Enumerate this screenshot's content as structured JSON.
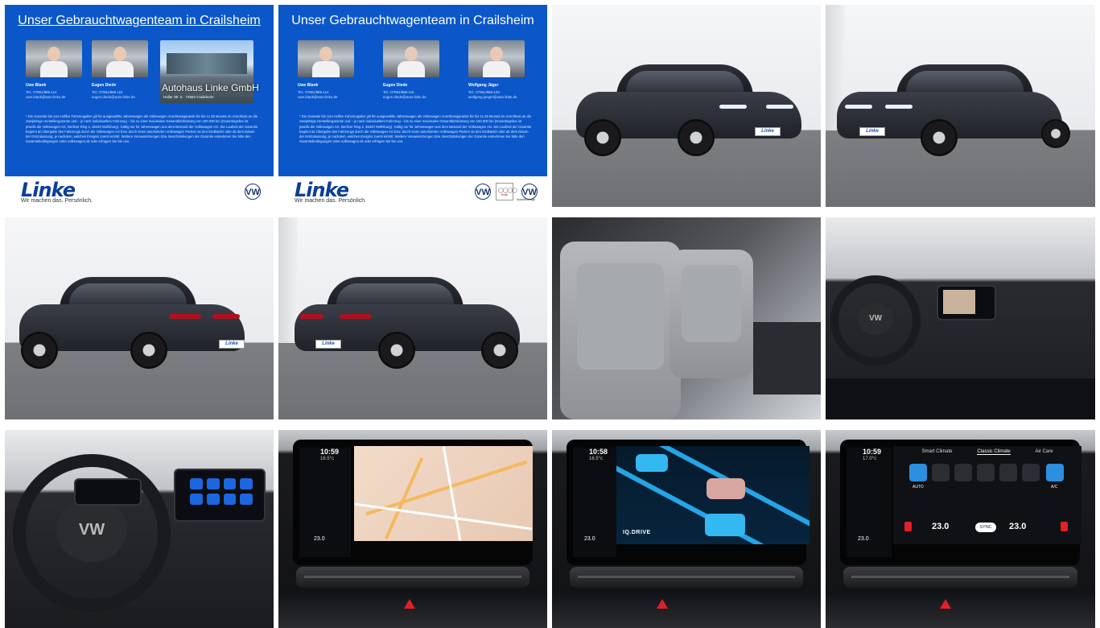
{
  "gallery": {
    "dealer_tile_1": {
      "heading": "Unser Gebrauchtwagenteam in Crailsheim",
      "staff": [
        {
          "name": "Uwe Blank",
          "contact": "Tel.: 07951/985-114\nuwe.blank@auto-linke.de"
        },
        {
          "name": "Eugen Diede",
          "contact": "Tel.: 07951/985-115\neugen.diede@auto-linke.de"
        }
      ],
      "building_label": "Autohaus Linke GmbH",
      "building_address": "Haller Str. 6 · 74564 Crailsheim",
      "fineprint": "* Die Garantie bis zum Hoffen Fahrzeugalter gilt für ausgewählte Jahreswagen als Volkswagen Anschlussgarantie für bis zu 36 Monate im Anschluss an die zweijährige Herstellergarantie und – je nach individuellem Fahrzeug – bis zu einer maximalen Gesamtfahrleistung von 100.000 km (Garantiegeber ist jeweils die Volkswagen AG, Berliner Ring 2, 38440 Wolfsburg). Gültig nur für Jahreswagen aus dem Bestand der Volkswagen AG. Die Laufzeit der Garantie beginnt ab Übergabe des Fahrzeugs durch die Volkswagen AG bzw. durch einen autorisierten Volkswagen Partner an den Endkäufer oder ab dem Datum der Erstzulassung, je nachdem, welches Ereignis zuerst eintritt. Weitere Voraussetzungen bzw. Beschränkungen der Garantie entnehmen Sie bitte den Garantiebedingungen unter volkswagen.de oder erfragen Sie bei uns.",
      "logo": "Linke",
      "slogan": "Wir machen das. Persönlich.",
      "brand_badge": "VW"
    },
    "dealer_tile_2": {
      "heading": "Unser Gebrauchtwagenteam in Crailsheim",
      "staff": [
        {
          "name": "Uwe Blank",
          "contact": "Tel.: 07951/985-114\nuwe.blank@auto-linke.de"
        },
        {
          "name": "Eugen Diede",
          "contact": "Tel.: 07951/985-115\neugen.diede@auto-linke.de"
        },
        {
          "name": "Wolfgang Jäger",
          "contact": "Tel.: 07951/985-106\nwolfgang.jaeger@auto-linke.de"
        }
      ],
      "fineprint": "* Die Garantie bis zum Hoffen Fahrzeugalter gilt für ausgewählte Jahreswagen als Volkswagen Anschlussgarantie für bis zu 36 Monate im Anschluss an die zweijährige Herstellergarantie und – je nach individuellem Fahrzeug – bis zu einer maximalen Gesamtfahrleistung von 100.000 km (Garantiegeber ist jeweils die Volkswagen AG, Berliner Ring 2, 38440 Wolfsburg). Gültig nur für Jahreswagen aus dem Bestand der Volkswagen AG. Die Laufzeit der Garantie beginnt ab Übergabe des Fahrzeugs durch die Volkswagen AG bzw. durch einen autorisierten Volkswagen Partner an den Endkäufer oder ab dem Datum der Erstzulassung, je nachdem, welches Ereignis zuerst eintritt. Weitere Voraussetzungen bzw. Beschränkungen der Garantie entnehmen Sie bitte den Garantiebedingungen unter volkswagen.de oder erfragen Sie bei uns.",
      "logo": "Linke",
      "slogan": "Wir machen das. Persönlich.",
      "brand_badge": "VW",
      "audi_label": "Audi Service",
      "nutzfahrzeuge_label": "Nutzfahrzeuge"
    },
    "plate_text": "Linke",
    "steering_badge": "VW",
    "nav_screen": {
      "time": "10:59",
      "temp": "16.5°c",
      "seat_temp": "23.0"
    },
    "assist_screen": {
      "time": "10:58",
      "temp": "16.5°c",
      "seat_temp": "23.0",
      "brand": "IQ.DRIVE"
    },
    "climate_screen": {
      "time": "10:59",
      "temp": "17.0°c",
      "tabs": [
        "Smart Climate",
        "Classic Climate",
        "Air Care"
      ],
      "auto_label": "AUTO",
      "ac_label": "A/C",
      "left_temp": "23.0",
      "right_temp": "23.0",
      "sync_label": "SYNC",
      "seat_temp": "23.0"
    },
    "colors": {
      "dealer_blue": "#0b57c9",
      "brand_navy": "#0b3e99",
      "screen_accent": "#2c8fe0",
      "hazard_red": "#e0202a"
    }
  }
}
